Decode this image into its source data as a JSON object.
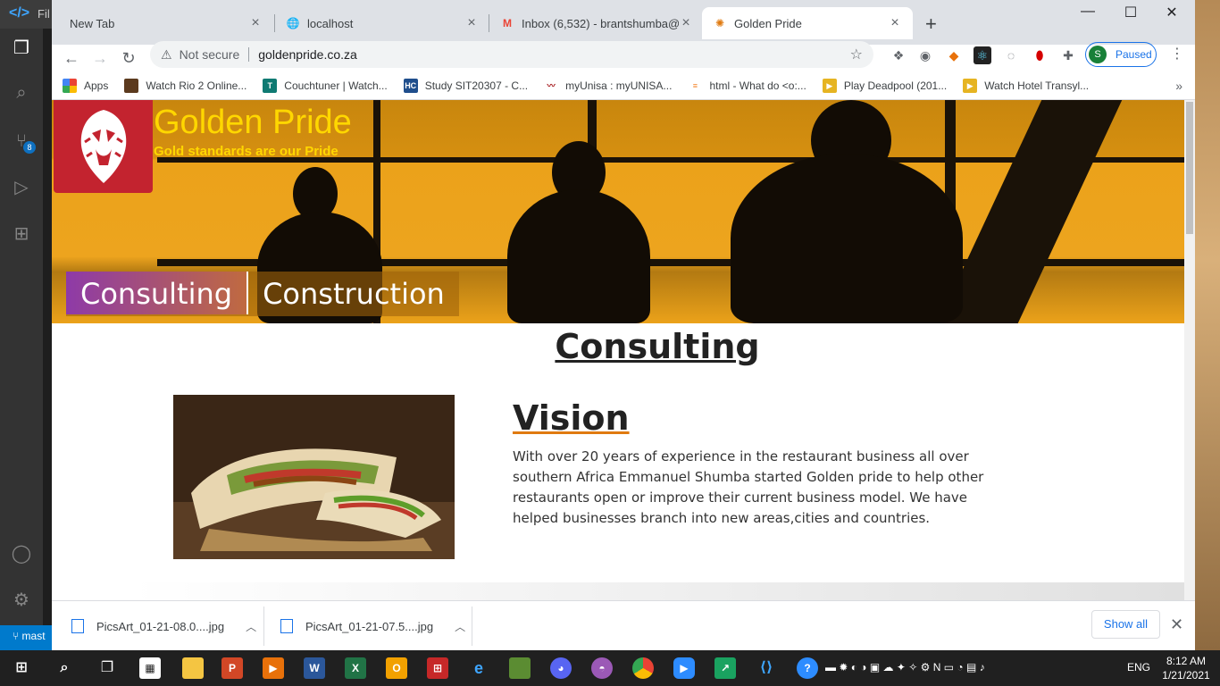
{
  "vscode": {
    "menu_label": "Fil",
    "scm_badge": "8",
    "status_branch": "mast"
  },
  "chrome": {
    "tabs": [
      {
        "title": "New Tab",
        "icon": "none"
      },
      {
        "title": "localhost",
        "icon": "globe-icon"
      },
      {
        "title": "Inbox (6,532) - brantshumba@gmail.com",
        "icon": "gmail-icon"
      },
      {
        "title": "Golden Pride",
        "icon": "golden-pride-favicon"
      }
    ],
    "omnibox": {
      "security_label": "Not secure",
      "url": "goldenpride.co.za"
    },
    "profile_initial": "S",
    "profile_label": "Paused",
    "bookmarks": [
      {
        "label": "Apps",
        "color": "#ea4335"
      },
      {
        "label": "Watch Rio 2 Online...",
        "color": "#5c3a1e"
      },
      {
        "label": "Couchtuner | Watch...",
        "color": "#0f7a72"
      },
      {
        "label": "Study SIT20307 - C...",
        "color": "#1f4e8c"
      },
      {
        "label": "myUnisa : myUNISA...",
        "color": "#a4161a"
      },
      {
        "label": "html - What do <o:...",
        "color": "#f48024"
      },
      {
        "label": "Play Deadpool (201...",
        "color": "#e6b422"
      },
      {
        "label": "Watch Hotel Transyl...",
        "color": "#e6b422"
      }
    ]
  },
  "page": {
    "site_title": "Golden Pride",
    "tagline": "Gold standards are our Pride",
    "nav": [
      "Consulting",
      "Construction"
    ],
    "section_title": "Consulting",
    "vision_title": "Vision",
    "vision_text": "With over 20 years of experience in the restaurant business all over southern Africa Emmanuel Shumba started Golden pride to help other restaurants open or improve their current business model. We have helped businesses branch into new areas,cities and countries."
  },
  "downloads": {
    "items": [
      "PicsArt_01-21-08.0....jpg",
      "PicsArt_01-21-07.5....jpg"
    ],
    "show_all": "Show all"
  },
  "taskbar": {
    "language": "ENG",
    "time": "8:12 AM",
    "date": "1/21/2021"
  }
}
